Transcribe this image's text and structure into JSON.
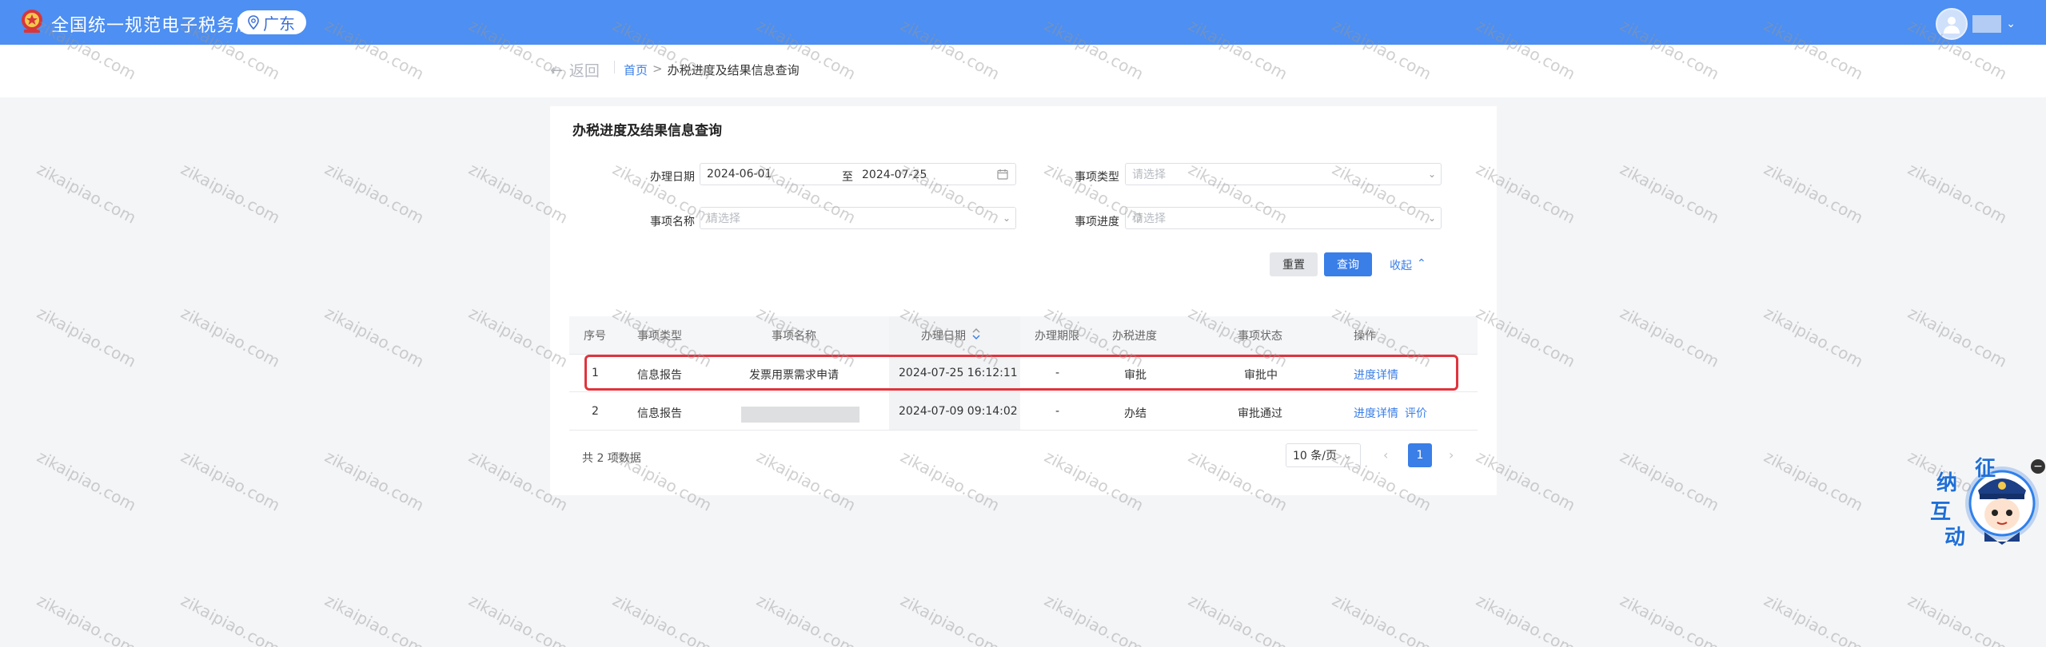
{
  "header": {
    "site_title": "全国统一规范电子税务局",
    "region": "广东",
    "emblem_icon": "tax-emblem-icon",
    "colors": {
      "topbar": "#4d8ff2",
      "accent": "#3a7ee8",
      "highlight": "#e0343d"
    }
  },
  "nav": {
    "back_label": "返回",
    "breadcrumb_home": "首页",
    "breadcrumb_separator": ">",
    "breadcrumb_current": "办税进度及结果信息查询"
  },
  "page_title": "办税进度及结果信息查询",
  "filters": {
    "handle_date_label": "办理日期",
    "date_start": "2024-06-01",
    "date_to": "至",
    "date_end": "2024-07-25",
    "item_type_label": "事项类型",
    "item_type_placeholder": "请选择",
    "item_name_label": "事项名称",
    "item_name_placeholder": "请选择",
    "item_progress_label": "事项进度",
    "item_progress_placeholder": "请选择",
    "reset_label": "重置",
    "query_label": "查询",
    "collapse_label": "收起"
  },
  "table": {
    "columns": [
      "序号",
      "事项类型",
      "事项名称",
      "办理日期",
      "办理期限",
      "办税进度",
      "事项状态",
      "操作"
    ],
    "rows": [
      {
        "index": "1",
        "type": "信息报告",
        "name": "发票用票需求申请",
        "date": "2024-07-25 16:12:11",
        "deadline": "-",
        "progress": "审批",
        "status": "审批中",
        "action1": "进度详情",
        "action2": ""
      },
      {
        "index": "2",
        "type": "信息报告",
        "name": "",
        "date": "2024-07-09 09:14:02",
        "deadline": "-",
        "progress": "办结",
        "status": "审批通过",
        "action1": "进度详情",
        "action2": "评价"
      }
    ]
  },
  "pagination": {
    "total_text": "共 2 项数据",
    "page_size": "10 条/页",
    "current_page": "1"
  },
  "mascot": {
    "text_chars": [
      "征",
      "纳",
      "互",
      "动"
    ],
    "close_symbol": "−"
  },
  "watermark_text": "zikaipiao.com"
}
